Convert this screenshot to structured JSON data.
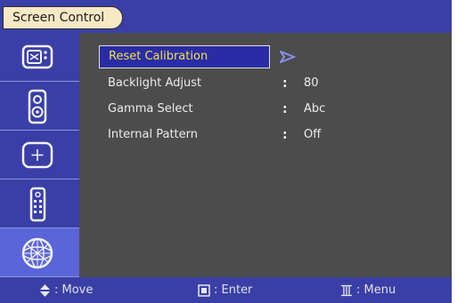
{
  "header": {
    "title": "Screen Control"
  },
  "sidebar": {
    "items": [
      {
        "icon": "monitor-icon"
      },
      {
        "icon": "speaker-icon"
      },
      {
        "icon": "crosshair-icon"
      },
      {
        "icon": "remote-icon"
      },
      {
        "icon": "wireframe-sphere-icon",
        "active": true
      }
    ]
  },
  "menu": {
    "selected": {
      "label": "Reset Calibration"
    },
    "items": [
      {
        "label": "Backlight Adjust",
        "sep": ":",
        "value": "80"
      },
      {
        "label": "Gamma Select",
        "sep": ":",
        "value": "Abc"
      },
      {
        "label": "Internal Pattern",
        "sep": ":",
        "value": "Off"
      }
    ]
  },
  "footer": {
    "move": ": Move",
    "enter": ": Enter",
    "menu": ": Menu"
  },
  "colors": {
    "bar": "#3a3fa8",
    "active": "#5a65da",
    "panel": "#4c4c4c",
    "highlight_text": "#f3e04a"
  }
}
